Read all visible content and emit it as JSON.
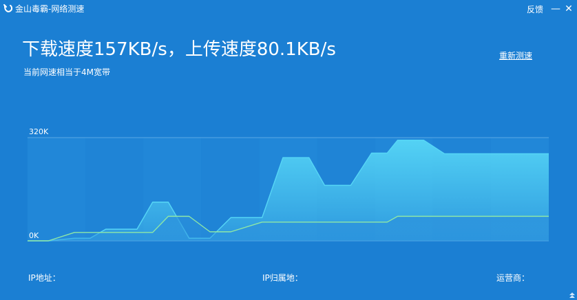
{
  "window": {
    "title": "金山毒霸-网络测速",
    "feedback_label": "反馈",
    "minimize_glyph": "—",
    "close_glyph": "✕",
    "icons": [
      "kingsoft-logo-icon",
      "minimize-icon",
      "close-icon",
      "resize-grip-icon"
    ]
  },
  "result": {
    "headline": "下载速度157KB/s，上传速度80.1KB/s",
    "subline": "当前网速相当于4M宽带",
    "retest_label": "重新测速"
  },
  "colors": {
    "background": "#1b7fd3",
    "download_line": "#56d6f6",
    "upload_line": "#8ee8a6",
    "grid": "#5aa8e6"
  },
  "chart_data": {
    "type": "area",
    "y_min_label": "0K",
    "y_max_label": "320K",
    "ylim": [
      0,
      320
    ],
    "x": [
      0,
      4,
      9,
      12,
      15,
      21,
      24,
      27,
      31,
      35,
      39,
      45,
      49,
      54,
      57,
      62,
      66,
      69,
      71,
      76,
      80,
      84,
      89,
      94,
      100
    ],
    "series": [
      {
        "key": "download",
        "values": [
          0,
          0,
          8,
          8,
          36,
          36,
          120,
          120,
          8,
          8,
          72,
          72,
          258,
          258,
          172,
          172,
          272,
          272,
          312,
          312,
          270,
          270,
          270,
          270,
          270
        ]
      },
      {
        "key": "upload",
        "values": [
          0,
          0,
          26,
          26,
          26,
          26,
          26,
          76,
          76,
          28,
          28,
          58,
          58,
          58,
          58,
          58,
          58,
          58,
          76,
          76,
          76,
          76,
          76,
          76,
          76
        ]
      }
    ],
    "grid": true
  },
  "footer": {
    "ip_label": "IP地址：",
    "location_label": "IP归属地：",
    "isp_label": "运营商："
  }
}
